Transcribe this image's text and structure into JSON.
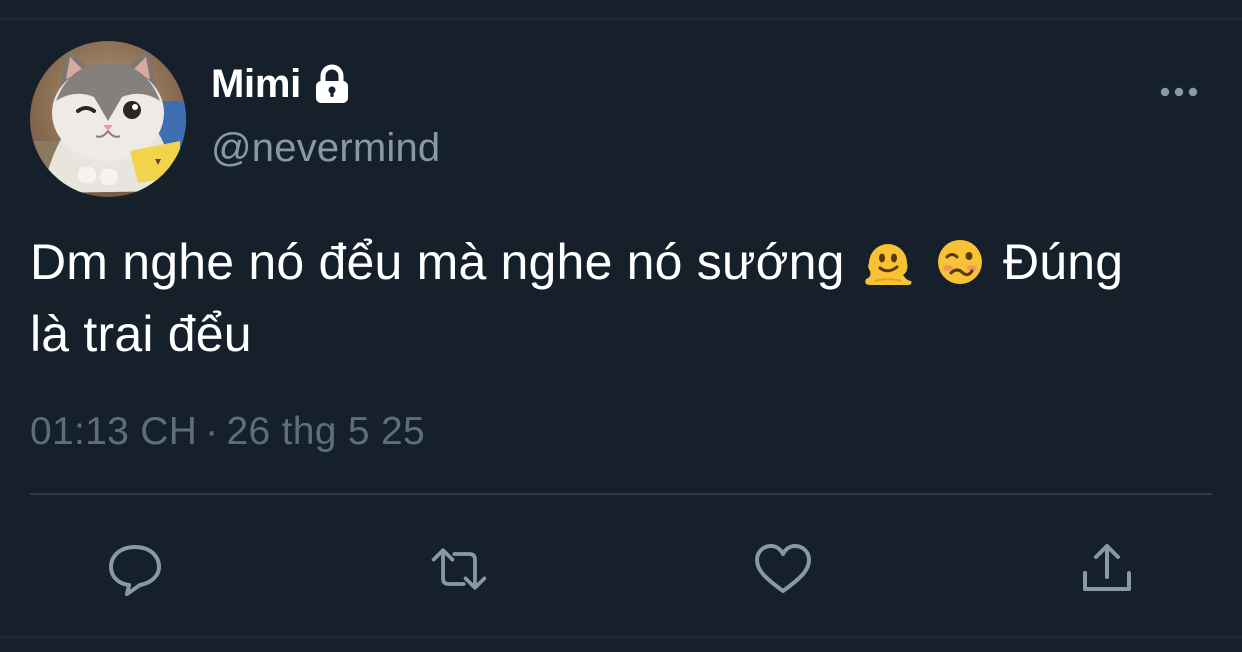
{
  "author": {
    "display_name": "Mimi",
    "handle": "@nevermind",
    "protected_icon": "lock-icon",
    "avatar_icon": "cat-avatar"
  },
  "tweet": {
    "line1_part1": "Dm nghe nó đểu mà nghe nó sướng",
    "line1_part2": "Đúng",
    "line2": "là trai đểu",
    "emojis": [
      "melting-face-emoji",
      "woozy-face-emoji"
    ]
  },
  "meta": {
    "time": "01:13 CH",
    "separator": "·",
    "date": "26 thg 5 25"
  },
  "actions": {
    "icons": [
      "reply-icon",
      "retweet-icon",
      "like-icon",
      "share-icon"
    ]
  },
  "colors": {
    "background": "#15202b",
    "text_primary": "#ffffff",
    "text_secondary": "#8899a6",
    "timestamp": "#5c6e7e",
    "divider": "#2f3b48",
    "icon": "#8899a6"
  }
}
